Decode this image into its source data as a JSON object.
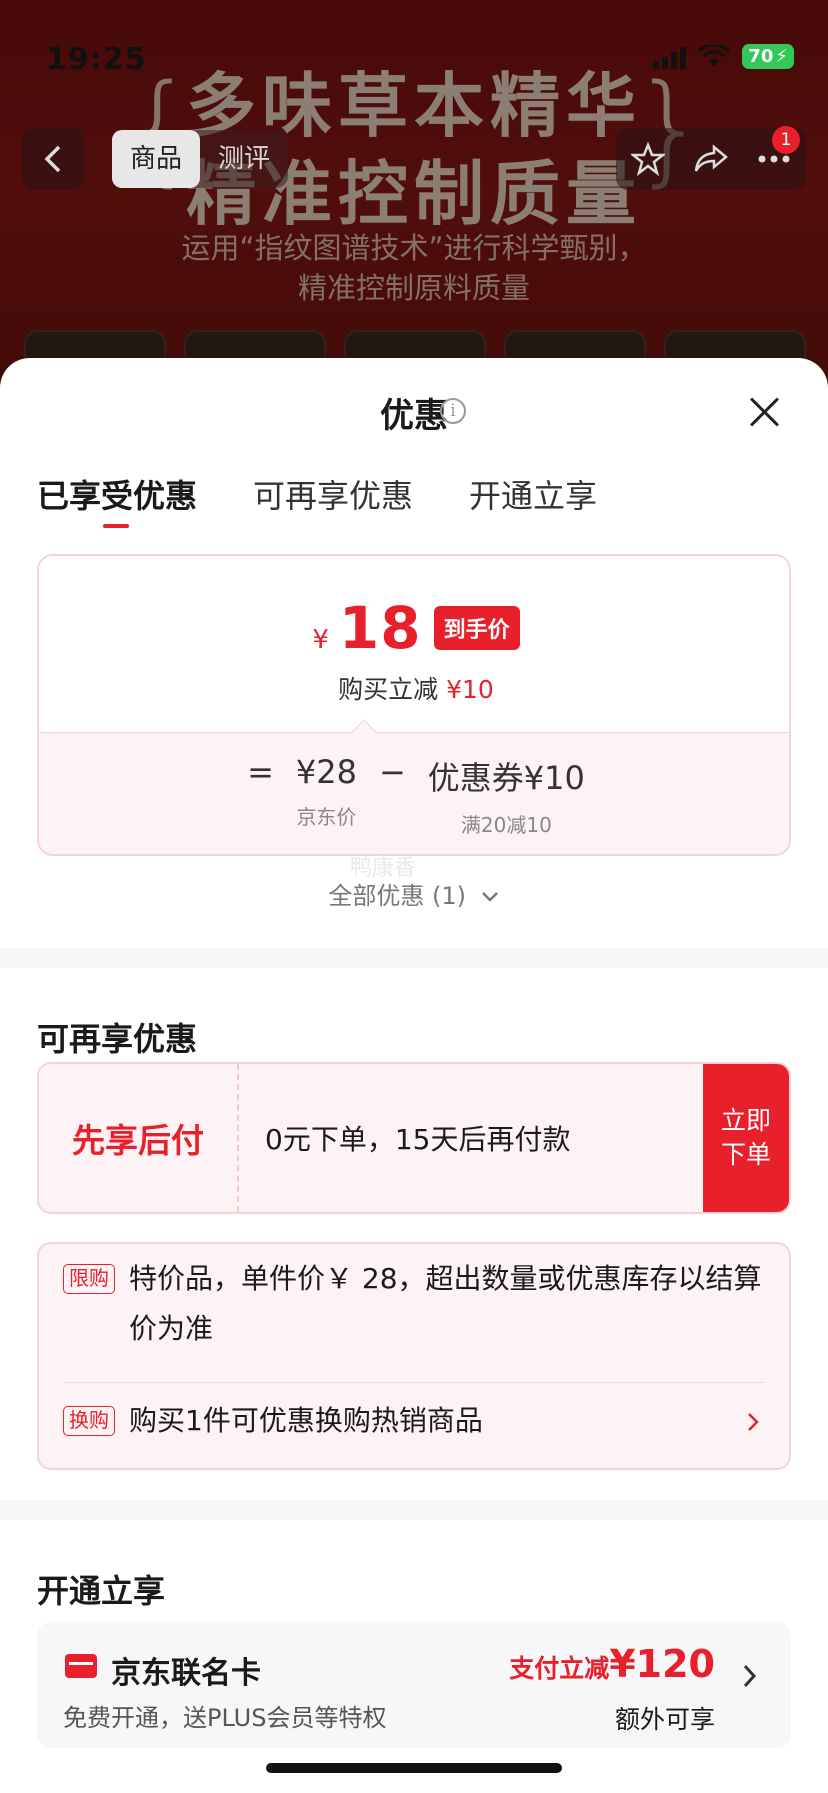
{
  "status_bar": {
    "time": "19:25",
    "battery": "70"
  },
  "background": {
    "headline_line1": "多味草本精华",
    "headline_line2": "精准控制质量",
    "sub_line1": "运用“指纹图谱技术”进行科学甄别，",
    "sub_line2": "精准控制原料质量",
    "tabs": [
      "商品",
      "测评"
    ],
    "cart_badge": "1"
  },
  "sheet": {
    "title": "优惠",
    "tabs": [
      {
        "label": "已享受优惠",
        "active": true
      },
      {
        "label": "可再享优惠",
        "active": false
      },
      {
        "label": "开通立享",
        "active": false
      }
    ],
    "price": {
      "currency": "¥",
      "amount": "18",
      "tag": "到手价",
      "desc_prefix": "购买立减",
      "desc_amount": "¥10"
    },
    "formula": {
      "eq": "=",
      "base_price": "¥28",
      "base_label": "京东价",
      "minus": "−",
      "coupon": "优惠券¥10",
      "coupon_label": "满20减10"
    },
    "watermark": "鸭康香",
    "all_offers": "全部优惠 (1)",
    "section_more": "可再享优惠",
    "pay_later": {
      "name": "先享后付",
      "desc": "0元下单，15天后再付款",
      "button": "立即下单"
    },
    "notes": [
      {
        "tag": "限购",
        "text": "特价品，单件价￥ 28，超出数量或优惠库存以结算价为准"
      },
      {
        "tag": "换购",
        "text": "购买1件可优惠换购热销商品"
      }
    ],
    "section_open": "开通立享",
    "co_card": {
      "name": "京东联名卡",
      "sub": "免费开通，送PLUS会员等特权",
      "promo_prefix": "支付立减",
      "promo_amount": "¥120",
      "extra": "额外可享"
    }
  },
  "colors": {
    "accent": "#e8202b",
    "card_bg": "#fdf3f4",
    "border": "#f5d4d8"
  }
}
